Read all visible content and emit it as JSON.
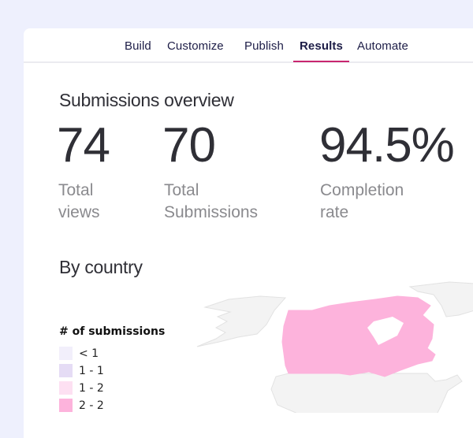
{
  "tabs": [
    {
      "label": "Build",
      "active": false
    },
    {
      "label": "Customize",
      "active": false
    },
    {
      "label": "Publish",
      "active": false
    },
    {
      "label": "Results",
      "active": true
    },
    {
      "label": "Automate",
      "active": false
    }
  ],
  "overview": {
    "title": "Submissions overview",
    "stats": [
      {
        "value": "74",
        "label_line1": "Total",
        "label_line2": "views"
      },
      {
        "value": "70",
        "label_line1": "Total",
        "label_line2": "Submissions"
      },
      {
        "value": "94.5%",
        "label_line1": "Completion",
        "label_line2": "rate"
      }
    ]
  },
  "by_country": {
    "title": "By country",
    "legend_title": "# of submissions",
    "legend": [
      {
        "label": "< 1",
        "color": "#f2effb"
      },
      {
        "label": "1 - 1",
        "color": "#e5dcf5"
      },
      {
        "label": "1 - 2",
        "color": "#fde0f2"
      },
      {
        "label": "2 - 2",
        "color": "#fdb3dc"
      }
    ],
    "map": {
      "highlighted_country": "Canada",
      "highlight_color": "#fdb3dc",
      "base_color": "#f3f3f3",
      "border_color": "#e2e2e2"
    }
  },
  "colors": {
    "background": "#eef0fd",
    "accent": "#c8266f",
    "tab_text": "#1d1d47"
  }
}
